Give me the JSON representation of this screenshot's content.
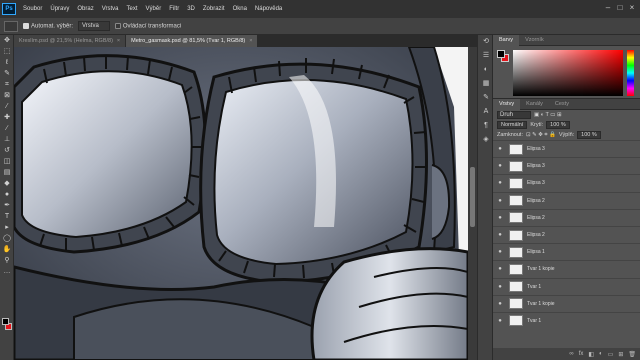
{
  "menu": [
    "Soubor",
    "Úpravy",
    "Obraz",
    "Vrstva",
    "Text",
    "Výběr",
    "Filtr",
    "3D",
    "Zobrazit",
    "Okna",
    "Nápověda"
  ],
  "app_logo": "Ps",
  "options": {
    "autoselect_label": "Automat. výběr:",
    "autoselect_value": "Vrstva",
    "transform_label": "Ovládací transformaci"
  },
  "tabs": [
    {
      "label": "Kreslím.psd @ 21,5% (Helma, RGB/8)",
      "active": false
    },
    {
      "label": "Metro_gasmask.psd @ 81,5% (Tvar 1, RGB/8)",
      "active": true
    }
  ],
  "panels": {
    "color_tabs": [
      "Barvy",
      "Vzorník"
    ],
    "layer_tabs": [
      "Vrstvy",
      "Kanály",
      "Cesty"
    ],
    "filter_kind": "Druh",
    "blend_mode": "Normální",
    "opacity_label": "Krytí:",
    "opacity_value": "100 %",
    "lock_label": "Zamknout:",
    "fill_label": "Výplň:",
    "fill_value": "100 %"
  },
  "layers": [
    {
      "name": "Elipsa 3",
      "selected": false
    },
    {
      "name": "Elipsa 3",
      "selected": false
    },
    {
      "name": "Elipsa 3",
      "selected": false
    },
    {
      "name": "Elipsa 2",
      "selected": false
    },
    {
      "name": "Elipsa 2",
      "selected": false
    },
    {
      "name": "Elipsa 2",
      "selected": false
    },
    {
      "name": "Elipsa 1",
      "selected": false
    },
    {
      "name": "Tvar 1 kopie",
      "selected": false
    },
    {
      "name": "Tvar 1",
      "selected": false
    },
    {
      "name": "Tvar 1 kopie",
      "selected": false
    },
    {
      "name": "Tvar 1",
      "selected": false
    }
  ],
  "colors": {
    "foreground": "#000000",
    "background": "#e3141b",
    "accent": "#31a8ff"
  }
}
